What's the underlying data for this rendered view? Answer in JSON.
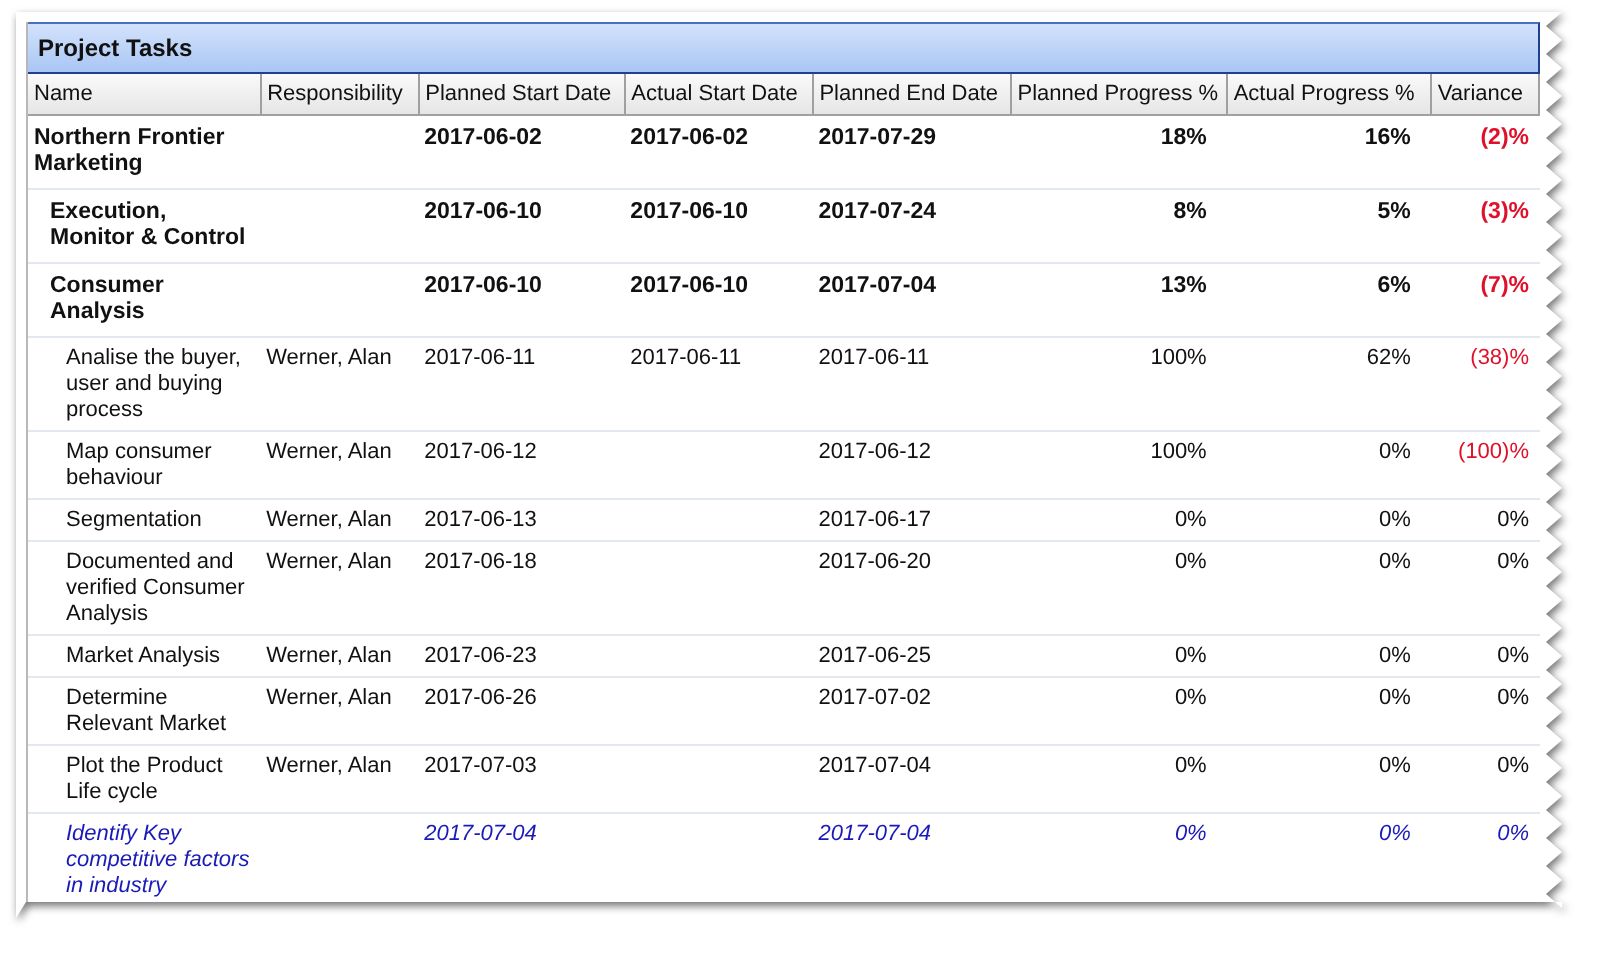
{
  "panel": {
    "title": "Project Tasks"
  },
  "table": {
    "columns": [
      "Name",
      "Responsibility",
      "Planned Start Date",
      "Actual Start Date",
      "Planned End Date",
      "Planned Progress %",
      "Actual Progress %",
      "Variance"
    ],
    "rows": [
      {
        "kind": "summary",
        "name": "Northern Frontier Marketing",
        "planned_start": "2017-06-02",
        "actual_start": "2017-06-02",
        "planned_end": "2017-07-29",
        "planned_progress": "18%",
        "actual_progress": "16%",
        "variance": "(2)%",
        "behind": true,
        "children": [
          {
            "kind": "summary",
            "name": "Execution, Monitor & Control",
            "planned_start": "2017-06-10",
            "actual_start": "2017-06-10",
            "planned_end": "2017-07-24",
            "planned_progress": "8%",
            "actual_progress": "5%",
            "variance": "(3)%",
            "behind": true
          },
          {
            "kind": "summary",
            "name": "Consumer Analysis",
            "planned_start": "2017-06-10",
            "actual_start": "2017-06-10",
            "planned_end": "2017-07-04",
            "planned_progress": "13%",
            "actual_progress": "6%",
            "variance": "(7)%",
            "behind": true,
            "children": [
              {
                "kind": "task",
                "name": "Analise the buyer, user and buying process",
                "responsibility": "Werner, Alan",
                "planned_start": "2017-06-11",
                "actual_start": "2017-06-11",
                "planned_end": "2017-06-11",
                "planned_progress": "100%",
                "actual_progress": "62%",
                "variance": "(38)%",
                "behind": true
              },
              {
                "kind": "task",
                "name": "Map consumer behaviour",
                "responsibility": "Werner, Alan",
                "planned_start": "2017-06-12",
                "planned_end": "2017-06-12",
                "planned_progress": "100%",
                "actual_progress": "0%",
                "variance": "(100)%",
                "behind": true
              },
              {
                "kind": "task",
                "name": "Segmentation",
                "responsibility": "Werner, Alan",
                "planned_start": "2017-06-13",
                "planned_end": "2017-06-17",
                "planned_progress": "0%",
                "actual_progress": "0%",
                "variance": "0%",
                "behind": false
              },
              {
                "kind": "task",
                "name": "Documented and verified Consumer Analysis",
                "responsibility": "Werner, Alan",
                "planned_start": "2017-06-18",
                "planned_end": "2017-06-20",
                "planned_progress": "0%",
                "actual_progress": "0%",
                "variance": "0%",
                "behind": false
              },
              {
                "kind": "task",
                "name": "Market Analysis",
                "responsibility": "Werner, Alan",
                "planned_start": "2017-06-23",
                "planned_end": "2017-06-25",
                "planned_progress": "0%",
                "actual_progress": "0%",
                "variance": "0%",
                "behind": false
              },
              {
                "kind": "task",
                "name": "Determine Relevant Market",
                "responsibility": "Werner, Alan",
                "planned_start": "2017-06-26",
                "planned_end": "2017-07-02",
                "planned_progress": "0%",
                "actual_progress": "0%",
                "variance": "0%",
                "behind": false
              },
              {
                "kind": "task",
                "name": "Plot the Product Life cycle",
                "responsibility": "Werner, Alan",
                "planned_start": "2017-07-03",
                "planned_end": "2017-07-04",
                "planned_progress": "0%",
                "actual_progress": "0%",
                "variance": "0%",
                "behind": false
              },
              {
                "kind": "milestone",
                "name": "Identify Key competitive factors in industry",
                "planned_start": "2017-07-04",
                "planned_end": "2017-07-04",
                "planned_progress": "0%",
                "actual_progress": "0%",
                "variance": "0%",
                "behind": false
              }
            ]
          }
        ]
      }
    ]
  }
}
